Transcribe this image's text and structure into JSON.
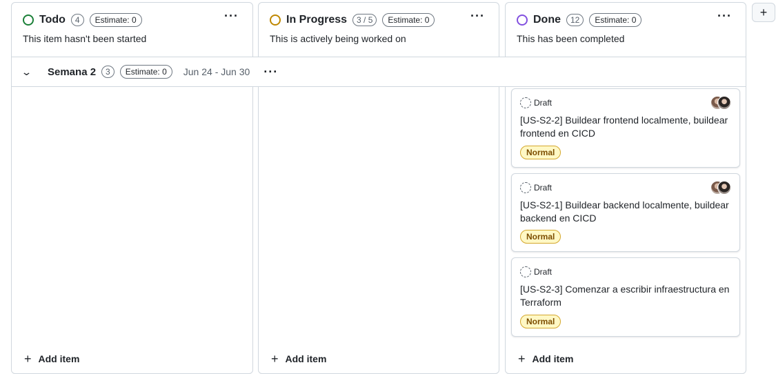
{
  "columns": [
    {
      "title": "Todo",
      "count": "4",
      "estimate": "Estimate: 0",
      "description": "This item hasn't been started",
      "color": "#1a7f37",
      "add_label": "Add item"
    },
    {
      "title": "In Progress",
      "count": "3 / 5",
      "estimate": "Estimate: 0",
      "description": "This is actively being worked on",
      "color": "#bf8700",
      "add_label": "Add item"
    },
    {
      "title": "Done",
      "count": "12",
      "estimate": "Estimate: 0",
      "description": "This has been completed",
      "color": "#8250df",
      "add_label": "Add item"
    }
  ],
  "group": {
    "title": "Semana 2",
    "count": "3",
    "estimate": "Estimate: 0",
    "dates": "Jun 24 - Jun 30"
  },
  "cards": [
    {
      "status": "Draft",
      "title": "[US-S2-2] Buildear frontend localmente, buildear frontend en CICD",
      "label": "Normal",
      "has_assignees": true
    },
    {
      "status": "Draft",
      "title": "[US-S2-1] Buildear backend localmente, buildear backend en CICD",
      "label": "Normal",
      "has_assignees": true
    },
    {
      "status": "Draft",
      "title": "[US-S2-3] Comenzar a escribir infraestructura en Terraform",
      "label": "Normal",
      "has_assignees": false
    }
  ],
  "icons": {
    "menu": "more-horizontal-icon",
    "add": "plus-icon",
    "collapse": "chevron-down-icon",
    "draft": "draft-issue-icon"
  },
  "colors": {
    "label_bg": "#fff8c5",
    "label_text": "#7d4e00",
    "border": "#d0d7de"
  }
}
